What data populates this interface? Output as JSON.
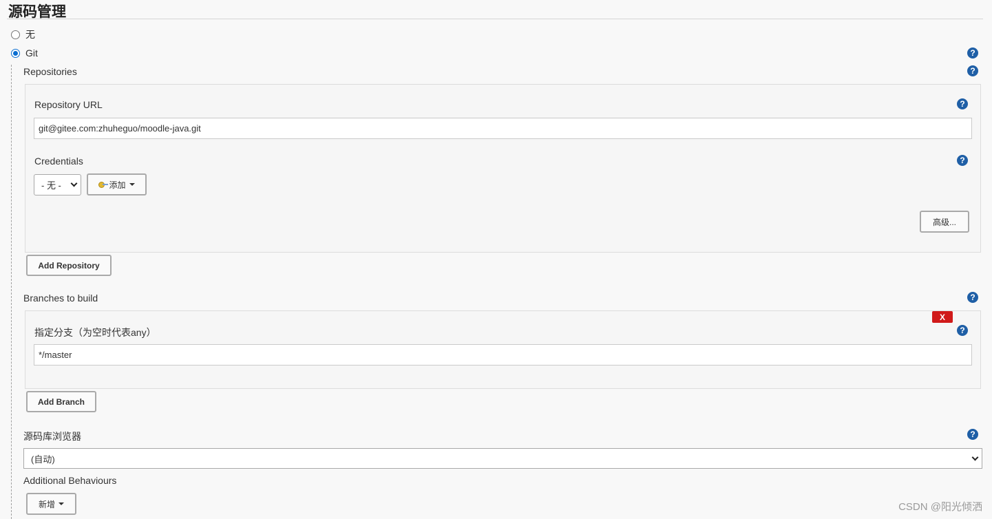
{
  "section": {
    "title": "源码管理"
  },
  "scm_options": [
    {
      "label": "无",
      "checked": false
    },
    {
      "label": "Git",
      "checked": true
    }
  ],
  "repositories": {
    "label": "Repositories",
    "url_label": "Repository URL",
    "url_value": "git@gitee.com:zhuheguo/moodle-java.git",
    "credentials_label": "Credentials",
    "credentials_selected": "- 无 -",
    "add_credentials_label": "添加",
    "advanced_label": "高级...",
    "add_repository_label": "Add Repository"
  },
  "branches": {
    "label": "Branches to build",
    "delete_label": "X",
    "specifier_label": "指定分支（为空时代表any）",
    "specifier_value": "*/master",
    "add_branch_label": "Add Branch"
  },
  "browser": {
    "label": "源码库浏览器",
    "selected": "(自动)"
  },
  "behaviours": {
    "label": "Additional Behaviours",
    "add_label": "新增"
  },
  "help_label": "?",
  "watermark": "CSDN @阳光倾洒",
  "colors": {
    "help": "#1f5fa6",
    "delete": "#d01a1a",
    "radio_checked": "#0a6ed1"
  }
}
